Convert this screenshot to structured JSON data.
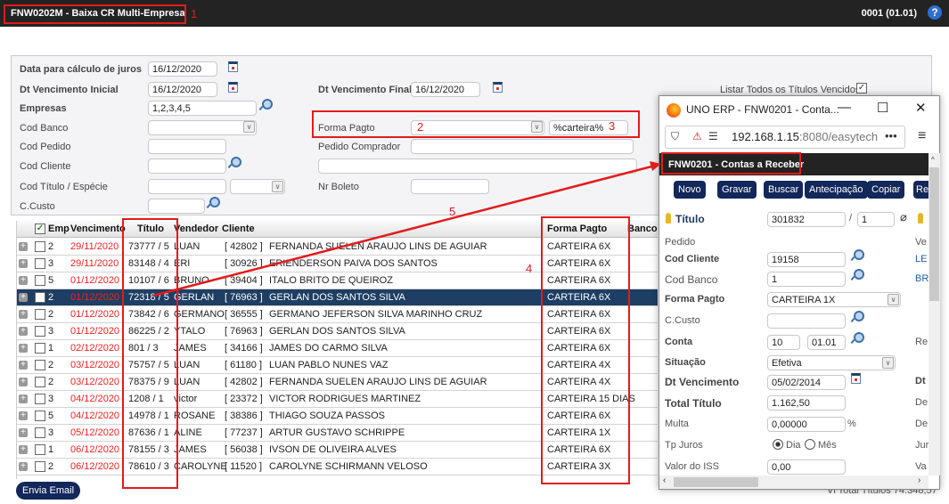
{
  "header": {
    "title": "FNW0202M - Baixa CR Multi-Empresa",
    "company": "0001 (01.01)",
    "help_icon": "help-icon"
  },
  "form": {
    "data_juros": {
      "label": "Data para cálculo de juros",
      "value": "16/12/2020"
    },
    "dt_venc_inicial": {
      "label": "Dt Vencimento Inicial",
      "value": "16/12/2020"
    },
    "dt_venc_final": {
      "label": "Dt Vencimento Final",
      "value": "16/12/2020"
    },
    "listar_todos": {
      "label": "Listar Todos os Títulos Vencidos",
      "checked": true
    },
    "empresas": {
      "label": "Empresas",
      "value": "1,2,3,4,5"
    },
    "cod_banco": {
      "label": "Cod Banco",
      "value": ""
    },
    "forma_pagto": {
      "label": "Forma Pagto",
      "value": "",
      "filter": "%carteira%"
    },
    "cod_pedido": {
      "label": "Cod Pedido",
      "value": ""
    },
    "pedido_comprador": {
      "label": "Pedido Comprador",
      "value": ""
    },
    "cod_cliente": {
      "label": "Cod Cliente",
      "value": ""
    },
    "cod_titulo": {
      "label": "Cod Título / Espécie",
      "value": ""
    },
    "nr_boleto": {
      "label": "Nr Boleto",
      "value": ""
    },
    "ccusto": {
      "label": "C.Custo",
      "value": ""
    }
  },
  "grid": {
    "columns": [
      "Emp",
      "Vencimento",
      "Título",
      "Vendedor",
      "Cliente",
      "Forma Pagto",
      "Banco"
    ],
    "rows": [
      {
        "emp": "2",
        "venc": "29/11/2020",
        "titulo": "73777 / 5",
        "vend": "LUAN",
        "cod": "[ 42802 ]",
        "cliente": "FERNANDA SUELEN ARAUJO LINS DE AGUIAR",
        "forma": "CARTEIRA 6X"
      },
      {
        "emp": "3",
        "venc": "29/11/2020",
        "titulo": "83148 / 4",
        "vend": "ERI",
        "cod": "[ 30926 ]",
        "cliente": "ERIENDERSON PAIVA DOS SANTOS",
        "forma": "CARTEIRA 6X"
      },
      {
        "emp": "5",
        "venc": "01/12/2020",
        "titulo": "10107 / 6",
        "vend": "BRUNO",
        "cod": "[ 39404 ]",
        "cliente": "ITALO BRITO DE QUEIROZ",
        "forma": "CARTEIRA 6X"
      },
      {
        "emp": "2",
        "venc": "01/12/2020",
        "titulo": "72318 / 5",
        "vend": "GERLAN",
        "cod": "[ 76963 ]",
        "cliente": "GERLAN DOS SANTOS SILVA",
        "forma": "CARTEIRA 6X",
        "selected": true
      },
      {
        "emp": "2",
        "venc": "01/12/2020",
        "titulo": "73842 / 6",
        "vend": "GERMANO",
        "cod": "[ 36555 ]",
        "cliente": "GERMANO JEFERSON SILVA MARINHO CRUZ",
        "forma": "CARTEIRA 6X"
      },
      {
        "emp": "3",
        "venc": "01/12/2020",
        "titulo": "86225 / 2",
        "vend": "YTALO",
        "cod": "[ 76963 ]",
        "cliente": "GERLAN DOS SANTOS SILVA",
        "forma": "CARTEIRA 6X"
      },
      {
        "emp": "1",
        "venc": "02/12/2020",
        "titulo": "801 / 3",
        "vend": "JAMES",
        "cod": "[ 34166 ]",
        "cliente": "JAMES DO CARMO SILVA",
        "forma": "CARTEIRA 6X"
      },
      {
        "emp": "2",
        "venc": "03/12/2020",
        "titulo": "75757 / 5",
        "vend": "LUAN",
        "cod": "[ 61180 ]",
        "cliente": "LUAN PABLO NUNES VAZ",
        "forma": "CARTEIRA 4X"
      },
      {
        "emp": "2",
        "venc": "03/12/2020",
        "titulo": "78375 / 9",
        "vend": "LUAN",
        "cod": "[ 42802 ]",
        "cliente": "FERNANDA SUELEN ARAUJO LINS DE AGUIAR",
        "forma": "CARTEIRA 4X"
      },
      {
        "emp": "3",
        "venc": "04/12/2020",
        "titulo": "1208 / 1",
        "vend": "victor",
        "cod": "[ 23372 ]",
        "cliente": "VICTOR RODRIGUES MARTINEZ",
        "forma": "CARTEIRA 15 DIAS"
      },
      {
        "emp": "5",
        "venc": "04/12/2020",
        "titulo": "14978 / 1",
        "vend": "ROSANE",
        "cod": "[ 38386 ]",
        "cliente": "THIAGO SOUZA PASSOS",
        "forma": "CARTEIRA 6X"
      },
      {
        "emp": "3",
        "venc": "05/12/2020",
        "titulo": "87636 / 1",
        "vend": "ALINE",
        "cod": "[ 77237 ]",
        "cliente": "ARTUR GUSTAVO SCHRIPPE",
        "forma": "CARTEIRA 1X"
      },
      {
        "emp": "1",
        "venc": "06/12/2020",
        "titulo": "78155 / 3",
        "vend": "JAMES",
        "cod": "[ 56038 ]",
        "cliente": "IVSON DE OLIVEIRA ALVES",
        "forma": "CARTEIRA 6X"
      },
      {
        "emp": "2",
        "venc": "06/12/2020",
        "titulo": "78610 / 3",
        "vend": "CAROLYNE",
        "cod": "[ 11520 ]",
        "cliente": "CAROLYNE SCHIRMANN VELOSO",
        "forma": "CARTEIRA 3X"
      }
    ]
  },
  "footer": {
    "envia_email": "Envia Email",
    "vl_total": "Vl Total Títulos 74.348,57"
  },
  "popup": {
    "window_title": "UNO ERP - FNW0201 - Conta...",
    "url_host": "192.168.1.15",
    "url_rest": ":8080/easytech",
    "title": "FNW0201 - Contas a Receber",
    "buttons": [
      "Novo",
      "Gravar",
      "Buscar",
      "Antecipação",
      "Copiar",
      "Re"
    ],
    "fields": {
      "titulo": {
        "label": "Título",
        "value": "301832",
        "parcela": "1"
      },
      "pedido": {
        "label": "Pedido"
      },
      "cod_cliente": {
        "label": "Cod Cliente",
        "value": "19158",
        "side": "LE"
      },
      "cod_banco": {
        "label": "Cod Banco",
        "value": "1",
        "side": "BR"
      },
      "forma_pagto": {
        "label": "Forma Pagto",
        "value": "CARTEIRA 1X"
      },
      "ccusto": {
        "label": "C.Custo",
        "value": ""
      },
      "conta": {
        "label": "Conta",
        "value1": "10",
        "value2": "01.01",
        "side": "Re"
      },
      "situacao": {
        "label": "Situação",
        "value": "Efetiva"
      },
      "dt_venc": {
        "label": "Dt Vencimento",
        "value": "05/02/2014",
        "side": "Dt"
      },
      "total": {
        "label": "Total Título",
        "value": "1.162,50",
        "side": "De"
      },
      "multa": {
        "label": "Multa",
        "value": "0,00000",
        "unit": "%",
        "side": "De"
      },
      "tp_juros": {
        "label": "Tp Juros",
        "opt1": "Dia",
        "opt2": "Mês",
        "selected": "Dia",
        "side": "Jur"
      },
      "iss": {
        "label": "Valor do ISS",
        "value": "0,00",
        "side": "Va"
      },
      "ve": "Ve"
    }
  },
  "annotations": [
    "1",
    "2",
    "3",
    "4",
    "5"
  ],
  "colors": {
    "header_bg": "#232323",
    "selected_row": "#1f3e63",
    "overdue_date": "#e22222",
    "button_bg": "#12275a",
    "annotation": "#e21b1b"
  }
}
